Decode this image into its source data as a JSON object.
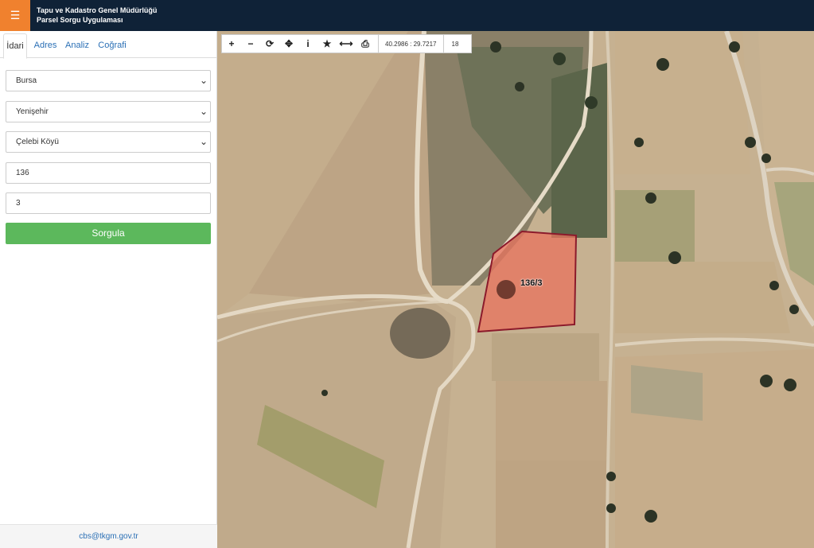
{
  "header": {
    "menu_icon": "☰",
    "title_line1": "Tapu ve Kadastro Genel Müdürlüğü",
    "title_line2": "Parsel Sorgu Uygulaması",
    "background": "#0f2237",
    "menu_color": "#f0812e"
  },
  "tabs": [
    {
      "label": "İdari",
      "active": true
    },
    {
      "label": "Adres",
      "active": false
    },
    {
      "label": "Analiz",
      "active": false
    },
    {
      "label": "Coğrafi",
      "active": false
    }
  ],
  "form": {
    "province": "Bursa",
    "district": "Yenişehir",
    "neighborhood": "Çelebi Köyü",
    "block": "136",
    "parcel": "3",
    "submit_label": "Sorgula",
    "chevron": "⌄"
  },
  "footer": {
    "email": "cbs@tkgm.gov.tr"
  },
  "toolbar": {
    "icons": [
      "plus-icon",
      "minus-icon",
      "refresh-icon",
      "crosshair-icon",
      "info-icon",
      "star-icon",
      "measure-icon",
      "print-icon"
    ],
    "glyphs": [
      "+",
      "−",
      "⟳",
      "✥",
      "i",
      "★",
      "⟷",
      "⎙"
    ],
    "coordinates": "40.2986 : 29.7217",
    "zoom": "18"
  },
  "map": {
    "parcel_label": "136/3",
    "parcel_fill": "#e8735e",
    "parcel_stroke": "#8b1a2b"
  }
}
